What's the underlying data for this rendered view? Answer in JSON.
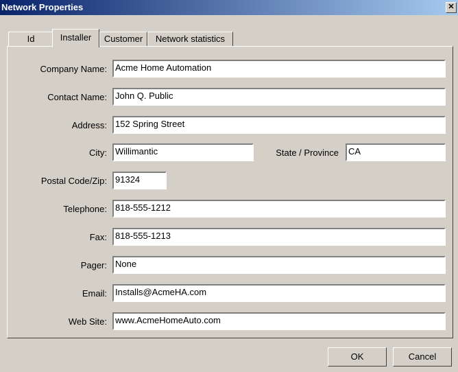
{
  "window": {
    "title": "Network Properties",
    "close_glyph": "✕"
  },
  "tabs": [
    {
      "label": "Id",
      "active": false
    },
    {
      "label": "Installer",
      "active": true
    },
    {
      "label": "Customer",
      "active": false
    },
    {
      "label": "Network statistics",
      "active": false
    }
  ],
  "form": {
    "company_name": {
      "label": "Company Name:",
      "value": "Acme Home Automation"
    },
    "contact_name": {
      "label": "Contact Name:",
      "value": "John Q. Public"
    },
    "address": {
      "label": "Address:",
      "value": "152 Spring Street"
    },
    "city": {
      "label": "City:",
      "value": "Willimantic"
    },
    "state": {
      "label": "State / Province",
      "value": "CA"
    },
    "postal": {
      "label": "Postal Code/Zip:",
      "value": "91324"
    },
    "telephone": {
      "label": "Telephone:",
      "value": "818-555-1212"
    },
    "fax": {
      "label": "Fax:",
      "value": "818-555-1213"
    },
    "pager": {
      "label": "Pager:",
      "value": "None"
    },
    "email": {
      "label": "Email:",
      "value": "Installs@AcmeHA.com"
    },
    "website": {
      "label": "Web Site:",
      "value": "www.AcmeHomeAuto.com"
    }
  },
  "buttons": {
    "ok": "OK",
    "cancel": "Cancel"
  }
}
